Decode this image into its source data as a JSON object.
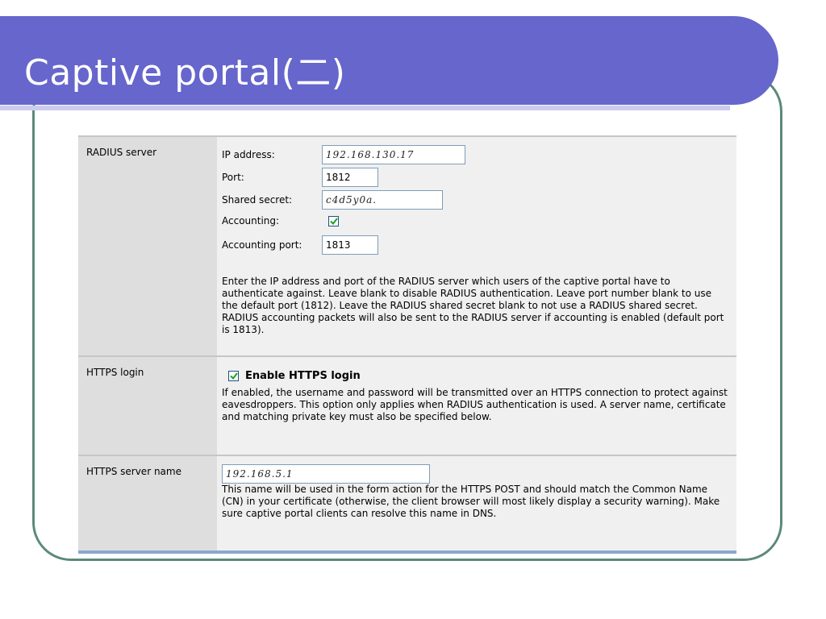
{
  "slide": {
    "title": "Captive portal(二)"
  },
  "radius": {
    "label": "RADIUS server",
    "ip_label": "IP address:",
    "ip_value": "192.168.130.17",
    "port_label": "Port:",
    "port_value": "1812",
    "secret_label": "Shared secret:",
    "secret_value": "c4d5y0a.",
    "accounting_label": "Accounting:",
    "accounting_checked": true,
    "accounting_port_label": "Accounting port:",
    "accounting_port_value": "1813",
    "help": "Enter the IP address and port of the RADIUS server which users of the captive portal have to authenticate against. Leave blank to disable RADIUS authentication. Leave port number blank to use the default port (1812). Leave the RADIUS shared secret blank to not use a RADIUS shared secret. RADIUS accounting packets will also be sent to the RADIUS server if accounting is enabled (default port is 1813)."
  },
  "https_login": {
    "label": "HTTPS login",
    "checkbox_label": "Enable HTTPS login",
    "checked": true,
    "help": "If enabled, the username and password will be transmitted over an HTTPS connection to protect against eavesdroppers. This option only applies when RADIUS authentication is used. A server name, certificate and matching private key must also be specified below."
  },
  "https_server": {
    "label": "HTTPS server name",
    "value": "192.168.5.1",
    "help": "This name will be used in the form action for the HTTPS POST and should match the Common Name (CN) in your certificate (otherwise, the client browser will most likely display a security warning). Make sure captive portal clients can resolve this name in DNS."
  },
  "colors": {
    "title_bar": "#6666cc",
    "frame": "#5c8a78",
    "check": "#21a121"
  }
}
